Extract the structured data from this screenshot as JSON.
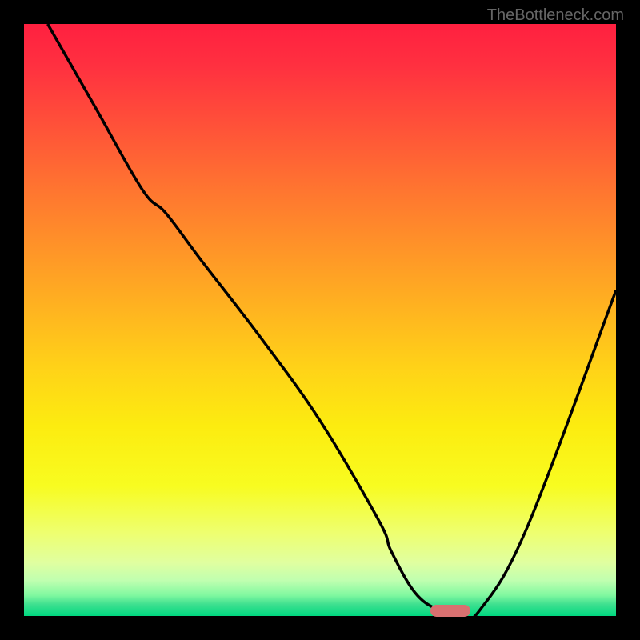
{
  "watermark": "TheBottleneck.com",
  "chart_data": {
    "type": "line",
    "title": "",
    "xlabel": "",
    "ylabel": "",
    "xlim": [
      0,
      100
    ],
    "ylim": [
      0,
      100
    ],
    "series": [
      {
        "name": "bottleneck-curve",
        "x": [
          4,
          12,
          20,
          24,
          30,
          40,
          50,
          60,
          62,
          66,
          70,
          74,
          77,
          85,
          100
        ],
        "y": [
          100,
          86,
          72,
          68,
          60,
          47,
          33,
          16,
          11,
          4,
          1,
          0,
          1,
          15,
          55
        ]
      }
    ],
    "marker": {
      "x": 72,
      "y": 0,
      "color": "#d87070"
    },
    "gradient_stops": [
      {
        "pct": 0,
        "color": "#ff2040"
      },
      {
        "pct": 50,
        "color": "#ffc020"
      },
      {
        "pct": 85,
        "color": "#f8ff50"
      },
      {
        "pct": 100,
        "color": "#00d880"
      }
    ]
  }
}
